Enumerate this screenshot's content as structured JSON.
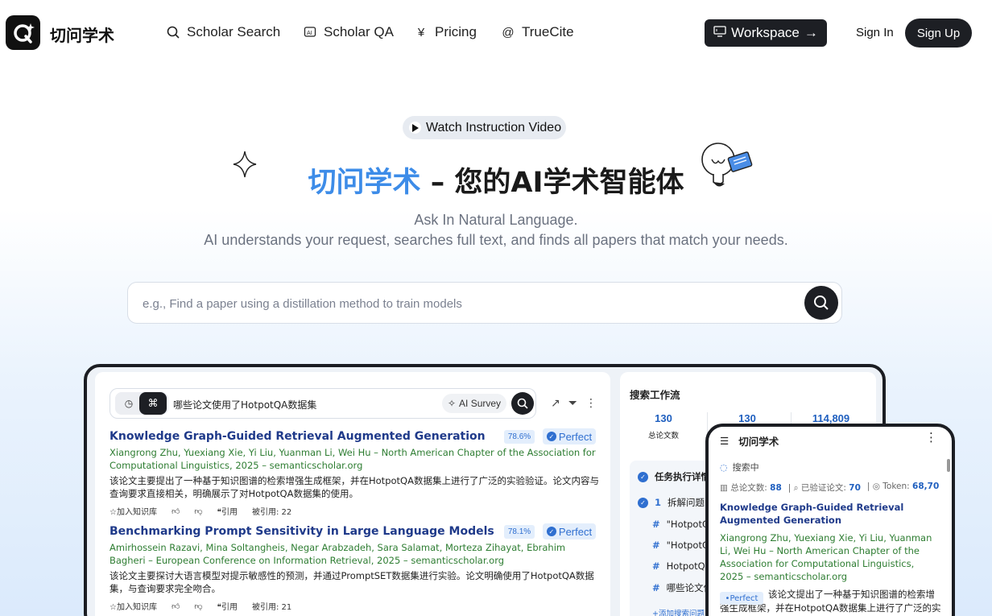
{
  "nav": {
    "logo_text": "切问学术",
    "links": [
      {
        "label": "Scholar Search",
        "icon": "search-icon"
      },
      {
        "label": "Scholar QA",
        "icon": "ai-chat-icon"
      },
      {
        "label": "Pricing",
        "icon": "yen-icon"
      },
      {
        "label": "TrueCite",
        "icon": "at-icon"
      }
    ],
    "workspace_label": "Workspace",
    "signin_label": "Sign In",
    "signup_label": "Sign Up"
  },
  "hero": {
    "watch_label": "Watch Instruction Video",
    "title_brand": "切问学术",
    "title_rest": " – 您的AI学术智能体",
    "subtitle_1": "Ask In Natural Language.",
    "subtitle_2": "AI understands your request, searches full text, and finds all papers that match your needs."
  },
  "search": {
    "placeholder": "e.g., Find a paper using a distillation method to train models"
  },
  "preview": {
    "query": "哪些论文使用了HotpotQA数据集",
    "ai_survey_label": "AI Survey",
    "papers": [
      {
        "title": "Knowledge Graph-Guided Retrieval Augmented Generation",
        "score": "78.6%",
        "badge": "Perfect",
        "authors": "Xiangrong Zhu, Yuexiang Xie, Yi Liu, Yuanman Li, Wei Hu – North American Chapter of the Association for Computational Linguistics, 2025 – semanticscholar.org",
        "summary": "该论文主要提出了一种基于知识图谱的检索增强生成框架，并在HotpotQA数据集上进行了广泛的实验验证。论文内容与查询要求直接相关，明确展示了对HotpotQA数据集的使用。",
        "add_kb": "加入知识库",
        "cite": "引用",
        "cited_by": "被引用: 22"
      },
      {
        "title": "Benchmarking Prompt Sensitivity in Large Language Models",
        "score": "78.1%",
        "badge": "Perfect",
        "authors": "Amirhossein Razavi, Mina Soltangheis, Negar Arabzadeh, Sara Salamat, Morteza Zihayat, Ebrahim Bagheri – European Conference on Information Retrieval, 2025 – semanticscholar.org",
        "summary": "该论文主要探讨大语言模型对提示敏感性的预测，并通过PromptSET数据集进行实验。论文明确使用了HotpotQA数据集，与查询要求完全吻合。",
        "add_kb": "加入知识库",
        "cite": "引用",
        "cited_by": "被引用: 21"
      }
    ],
    "workflow": {
      "title": "搜索工作流",
      "stats": [
        {
          "value": "130",
          "label": "总论文数"
        },
        {
          "value": "130",
          "label": ""
        },
        {
          "value": "114,809",
          "label": ""
        }
      ],
      "tasks_title": "任务执行详情",
      "step": "1",
      "step_label": "拆解问题",
      "subqueries": [
        "\"HotpotQA",
        "\"HotpotQA",
        "HotpotQA",
        "哪些论文使"
      ],
      "add_query": "+添加搜索问题"
    }
  },
  "phone": {
    "title": "切问学术",
    "status": "搜索中",
    "total_label": "总论文数:",
    "total_value": "88",
    "verified_label": "已验证论文:",
    "verified_value": "70",
    "token_label": "Token:",
    "token_value": "68,70",
    "paper_title": "Knowledge Graph-Guided Retrieval Augmented Generation",
    "paper_authors": "Xiangrong Zhu, Yuexiang Xie, Yi Liu, Yuanman Li, Wei Hu – North American Chapter of the Association for Computational Linguistics, 2025 – semanticscholar.org",
    "badge": "Perfect",
    "summary": "该论文提出了一种基于知识图谱的检索增强生成框架，并在HotpotQA数据集上进行了广泛的实验"
  },
  "colors": {
    "brand_blue": "#3d8ce8",
    "dark": "#1d1f24",
    "author_green": "#2e7d32",
    "title_navy": "#1f3a8a"
  }
}
